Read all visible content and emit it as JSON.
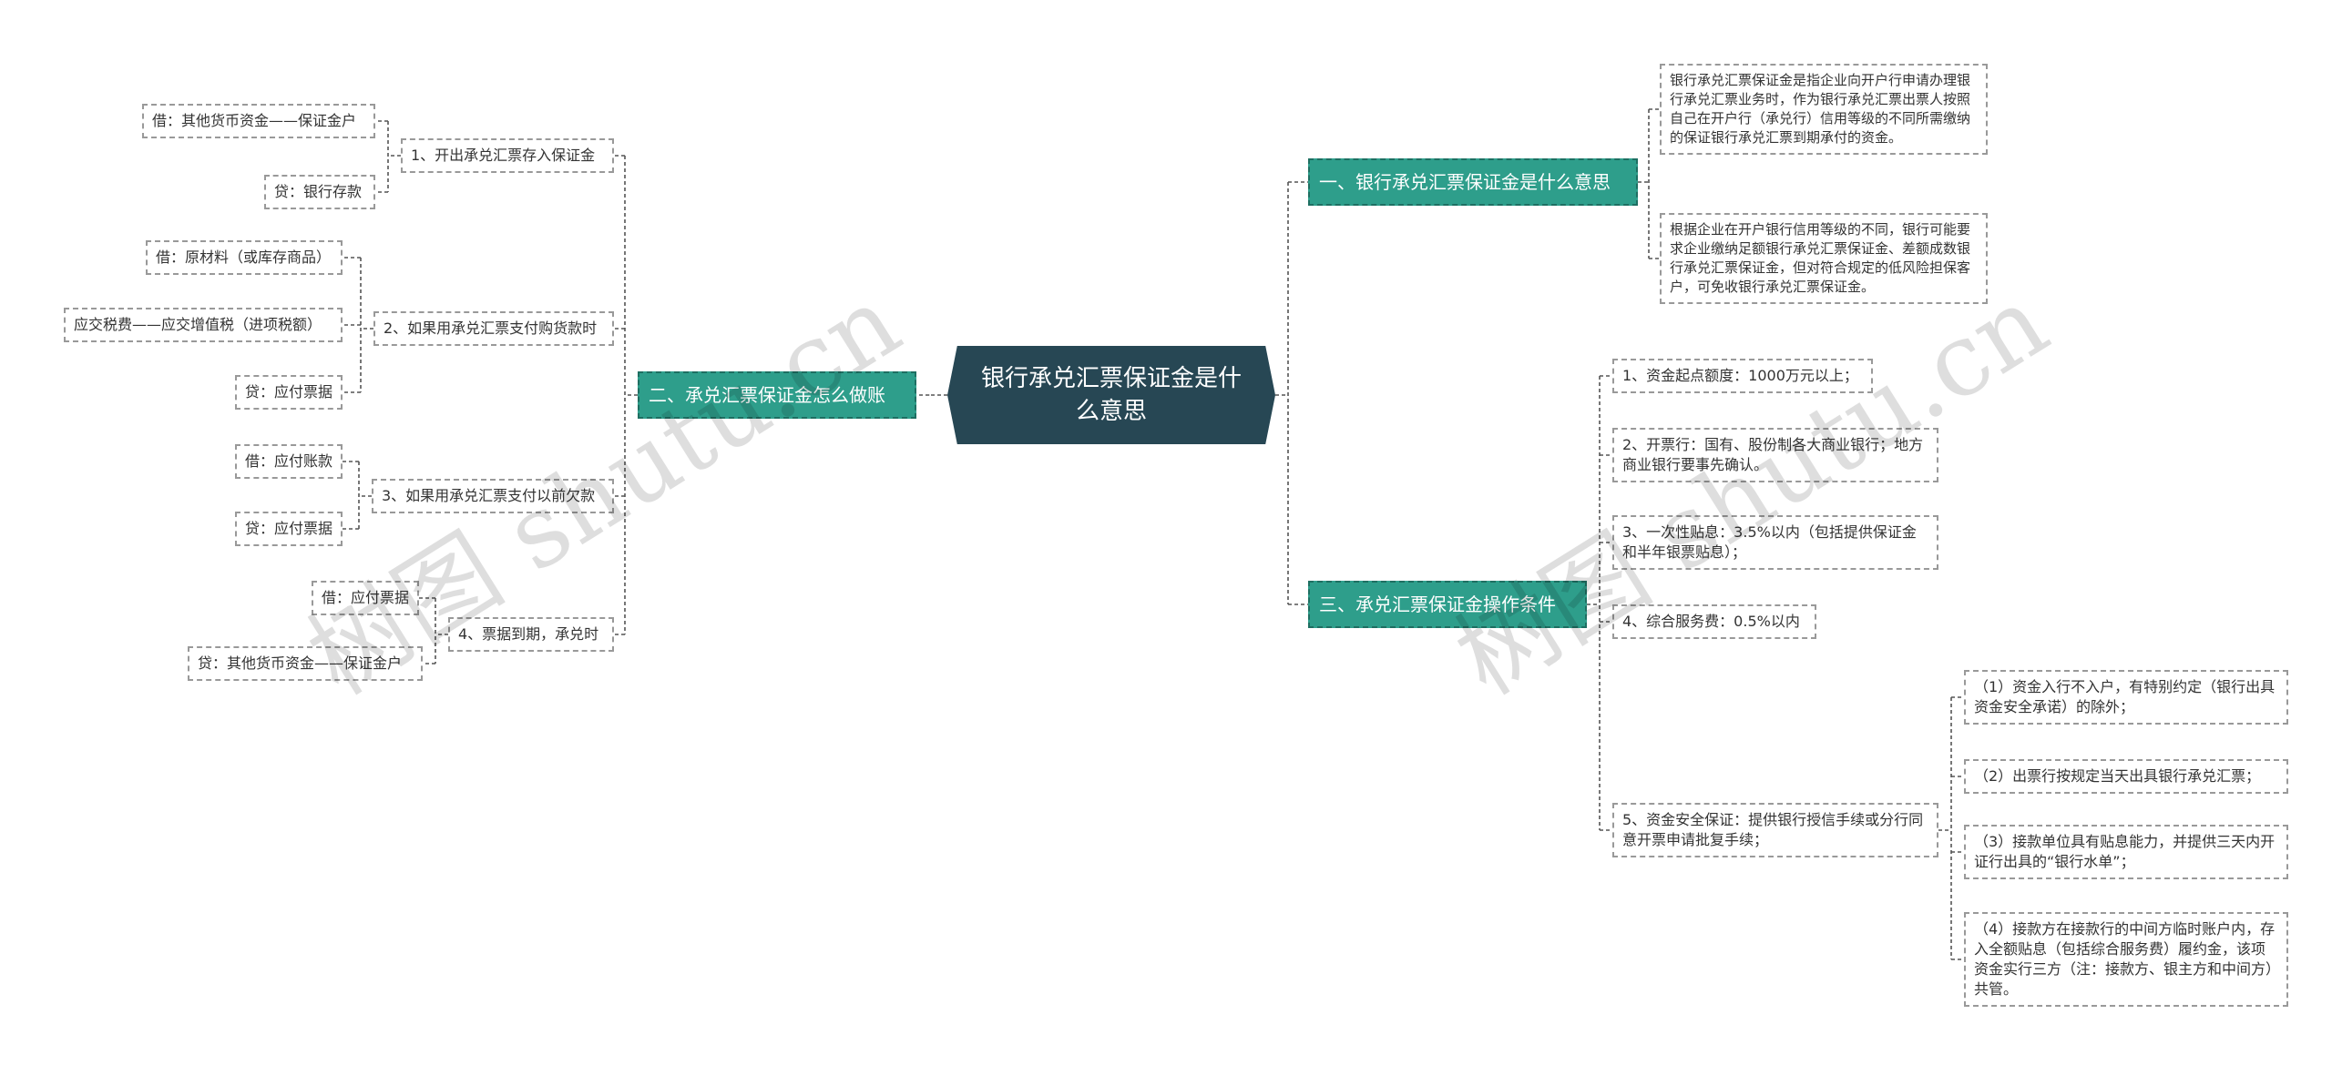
{
  "root": "银行承兑汇票保证金是什么意思",
  "right": [
    {
      "title": "一、银行承兑汇票保证金是什么意思",
      "children": [
        "银行承兑汇票保证金是指企业向开户行申请办理银行承兑汇票业务时，作为银行承兑汇票出票人按照自己在开户行（承兑行）信用等级的不同所需缴纳的保证银行承兑汇票到期承付的资金。",
        "根据企业在开户银行信用等级的不同，银行可能要求企业缴纳足额银行承兑汇票保证金、差额成数银行承兑汇票保证金，但对符合规定的低风险担保客户，可免收银行承兑汇票保证金。"
      ]
    },
    {
      "title": "三、承兑汇票保证金操作条件",
      "children": [
        "1、资金起点额度：1000万元以上；",
        "2、开票行：国有、股份制各大商业银行；地方商业银行要事先确认。",
        "3、一次性贴息：3.5%以内（包括提供保证金和半年银票贴息）；",
        "4、综合服务费：0.5%以内",
        "5、资金安全保证：提供银行授信手续或分行同意开票申请批复手续；"
      ],
      "sub5": [
        "（1）资金入行不入户，有特别约定（银行出具资金安全承诺）的除外；",
        "（2）出票行按规定当天出具银行承兑汇票；",
        "（3）接款单位具有贴息能力，并提供三天内开证行出具的“银行水单”；",
        "（4）接款方在接款行的中间方临时账户内，存入全额贴息（包括综合服务费）履约金，该项资金实行三方（注：接款方、银主方和中间方）共管。"
      ]
    }
  ],
  "left": {
    "title": "二、承兑汇票保证金怎么做账",
    "children": [
      {
        "label": "1、开出承兑汇票存入保证金",
        "entries": [
          "借：其他货币资金——保证金户",
          "贷：银行存款"
        ]
      },
      {
        "label": "2、如果用承兑汇票支付购货款时",
        "entries": [
          "借：原材料（或库存商品）",
          "应交税费——应交增值税（进项税额）",
          "贷：应付票据"
        ]
      },
      {
        "label": "3、如果用承兑汇票支付以前欠款",
        "entries": [
          "借：应付账款",
          "贷：应付票据"
        ]
      },
      {
        "label": "4、票据到期，承兑时",
        "entries": [
          "借：应付票据",
          "贷：其他货币资金——保证金户"
        ]
      }
    ]
  },
  "watermarks": [
    "树图 shutu.cn",
    "树图 shutu.cn"
  ],
  "colors": {
    "root": "#274754",
    "level1": "#2e9e8b",
    "line": "#555555",
    "leaf_border": "#999999"
  }
}
